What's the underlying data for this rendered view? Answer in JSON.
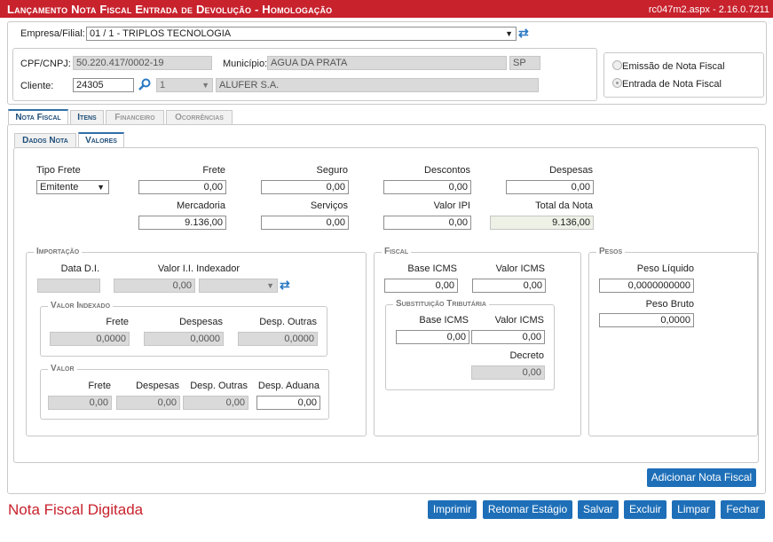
{
  "header": {
    "title": "Lançamento Nota Fiscal Entrada de Devolução   - Homologação",
    "version": "rc047m2.aspx - 2.16.0.7211"
  },
  "company": {
    "label": "Empresa/Filial:",
    "value": "01 / 1 - TRIPLOS TECNOLOGIA",
    "refresh_icon": "refresh-icon"
  },
  "client_info": {
    "cpf_label": "CPF/CNPJ:",
    "cpf_value": "50.220.417/0002-19",
    "municipio_label": "Município:",
    "municipio_value": "AGUA DA PRATA",
    "uf_value": "SP",
    "cliente_label": "Cliente:",
    "cliente_code": "24305",
    "search_icon": "search-icon",
    "cliente_seq": "1",
    "cliente_name": "ALUFER S.A."
  },
  "mode": {
    "options": [
      "Emissão de Nota Fiscal",
      "Entrada de Nota Fiscal"
    ],
    "selected": "Entrada de Nota Fiscal"
  },
  "tabs": [
    "Nota Fiscal",
    "Itens",
    "Financeiro",
    "Ocorrências"
  ],
  "active_tab": "Nota Fiscal",
  "subtabs": [
    "Dados Nota",
    "Valores"
  ],
  "active_subtab": "Valores",
  "valores": {
    "tipo_frete_label": "Tipo Frete",
    "tipo_frete_value": "Emitente",
    "frete_label": "Frete",
    "frete_value": "0,00",
    "seguro_label": "Seguro",
    "seguro_value": "0,00",
    "descontos_label": "Descontos",
    "descontos_value": "0,00",
    "despesas_label": "Despesas",
    "despesas_value": "0,00",
    "mercadoria_label": "Mercadoria",
    "mercadoria_value": "9.136,00",
    "servicos_label": "Serviços",
    "servicos_value": "0,00",
    "valor_ipi_label": "Valor IPI",
    "valor_ipi_value": "0,00",
    "total_label": "Total da Nota",
    "total_value": "9.136,00"
  },
  "importacao": {
    "legend": "Importação",
    "data_di_label": "Data D.I.",
    "data_di_value": "",
    "valor_ii_label": "Valor I.I. Indexador",
    "valor_ii_value": "0,00",
    "indexador_value": "",
    "valor_indexado": {
      "legend": "Valor Indexado",
      "frete_label": "Frete",
      "frete_value": "0,0000",
      "despesas_label": "Despesas",
      "despesas_value": "0,0000",
      "desp_outras_label": "Desp. Outras",
      "desp_outras_value": "0,0000"
    },
    "valor": {
      "legend": "Valor",
      "frete_label": "Frete",
      "frete_value": "0,00",
      "despesas_label": "Despesas",
      "despesas_value": "0,00",
      "desp_outras_label": "Desp. Outras",
      "desp_outras_value": "0,00",
      "desp_aduana_label": "Desp. Aduana",
      "desp_aduana_value": "0,00"
    }
  },
  "fiscal": {
    "legend": "Fiscal",
    "base_icms_label": "Base ICMS",
    "base_icms_value": "0,00",
    "valor_icms_label": "Valor ICMS",
    "valor_icms_value": "0,00",
    "subst": {
      "legend": "Substituição Tributária",
      "base_icms_label": "Base ICMS",
      "base_icms_value": "0,00",
      "valor_icms_label": "Valor ICMS",
      "valor_icms_value": "0,00",
      "decreto_label": "Decreto",
      "decreto_value": "0,00"
    }
  },
  "pesos": {
    "legend": "Pesos",
    "liquido_label": "Peso Líquido",
    "liquido_value": "0,0000000000",
    "bruto_label": "Peso Bruto",
    "bruto_value": "0,0000"
  },
  "actions": {
    "adicionar": "Adicionar Nota Fiscal",
    "imprimir": "Imprimir",
    "retomar": "Retomar Estágio",
    "salvar": "Salvar",
    "excluir": "Excluir",
    "limpar": "Limpar",
    "fechar": "Fechar"
  },
  "status_text": "Nota Fiscal Digitada",
  "colors": {
    "header_bg": "#c8222d",
    "button_bg": "#1e6fb8",
    "status_text": "#c8222d",
    "tab_active": "#1f4e79"
  }
}
